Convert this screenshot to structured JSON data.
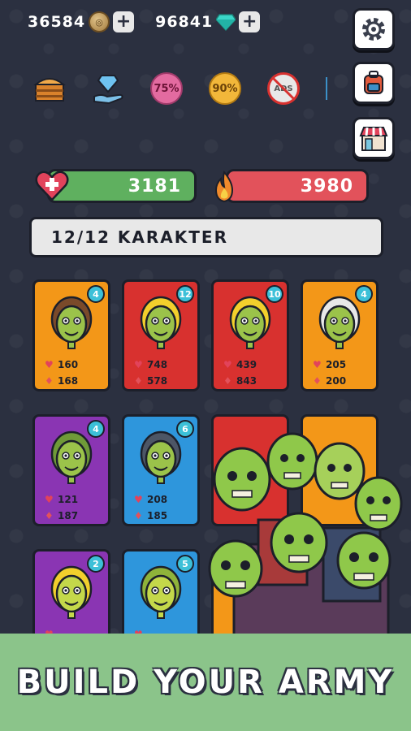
{
  "currency": {
    "coins": "36584",
    "gems": "96841"
  },
  "icons": {
    "chest": "treasure-chest-icon",
    "gem_offer": "gem-hand-icon",
    "discount1": "75%",
    "discount2": "90%",
    "no_ads": "ADS"
  },
  "stats": {
    "health": "3181",
    "attack": "3980"
  },
  "roster": {
    "count_label": "12/12 KARAKTER"
  },
  "cards": [
    {
      "level": "4",
      "hp": "160",
      "atk": "168",
      "color": "#f39718",
      "skin": "#9bc34a",
      "hair": "#7a4a2a"
    },
    {
      "level": "12",
      "hp": "748",
      "atk": "578",
      "color": "#d8312f",
      "skin": "#9bc34a",
      "hair": "#f2cf2c"
    },
    {
      "level": "10",
      "hp": "439",
      "atk": "843",
      "color": "#d8312f",
      "skin": "#9bc34a",
      "hair": "#f2cf2c"
    },
    {
      "level": "4",
      "hp": "205",
      "atk": "200",
      "color": "#f39718",
      "skin": "#9bc34a",
      "hair": "#e8e8e8"
    },
    {
      "level": "4",
      "hp": "121",
      "atk": "187",
      "color": "#8a35b3",
      "skin": "#9bc34a",
      "hair": "#6f9a38"
    },
    {
      "level": "6",
      "hp": "208",
      "atk": "185",
      "color": "#2e96dc",
      "skin": "#9bc34a",
      "hair": "#4d5666"
    },
    {
      "level": "2",
      "hp": "",
      "atk": "",
      "color": "#8a35b3",
      "skin": "#c4d84a",
      "hair": "#f2cf2c"
    },
    {
      "level": "5",
      "hp": "",
      "atk": "",
      "color": "#2e96dc",
      "skin": "#c4d84a",
      "hair": "#8fb33a"
    }
  ],
  "banner": {
    "text": "BUILD YOUR ARMY"
  }
}
